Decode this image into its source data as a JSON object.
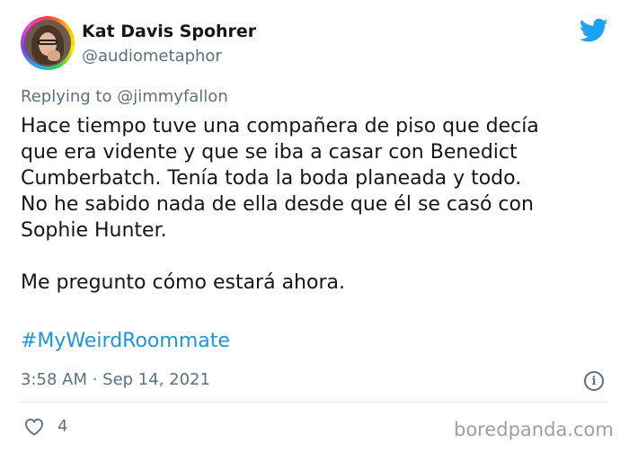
{
  "author": {
    "name": "Kat Davis Spohrer",
    "handle": "@audiometaphor"
  },
  "reply": {
    "prefix": "Replying to",
    "mention": "@jimmyfallon"
  },
  "tweet": {
    "lines": [
      "Hace tiempo tuve una compañera de piso que decía",
      "que era vidente y que se iba a casar con Benedict",
      "Cumberbatch. Tenía toda la boda planeada y todo.",
      "No he sabido nada de ella desde que él se casó con",
      "Sophie Hunter.",
      "Me pregunto cómo estará ahora."
    ],
    "hashtag": "#MyWeirdRoommate"
  },
  "meta": {
    "timestamp": "3:58 AM · Sep 14, 2021",
    "likes": "4"
  },
  "watermark": "boredpanda.com",
  "icons": {
    "brand": "twitter-bird-icon",
    "info": "info-icon",
    "like": "heart-icon"
  },
  "colors": {
    "twitter_blue": "#1da1f2",
    "hashtag": "#1b95e0",
    "secondary_text": "#5b7083",
    "primary_text": "#14171a"
  }
}
